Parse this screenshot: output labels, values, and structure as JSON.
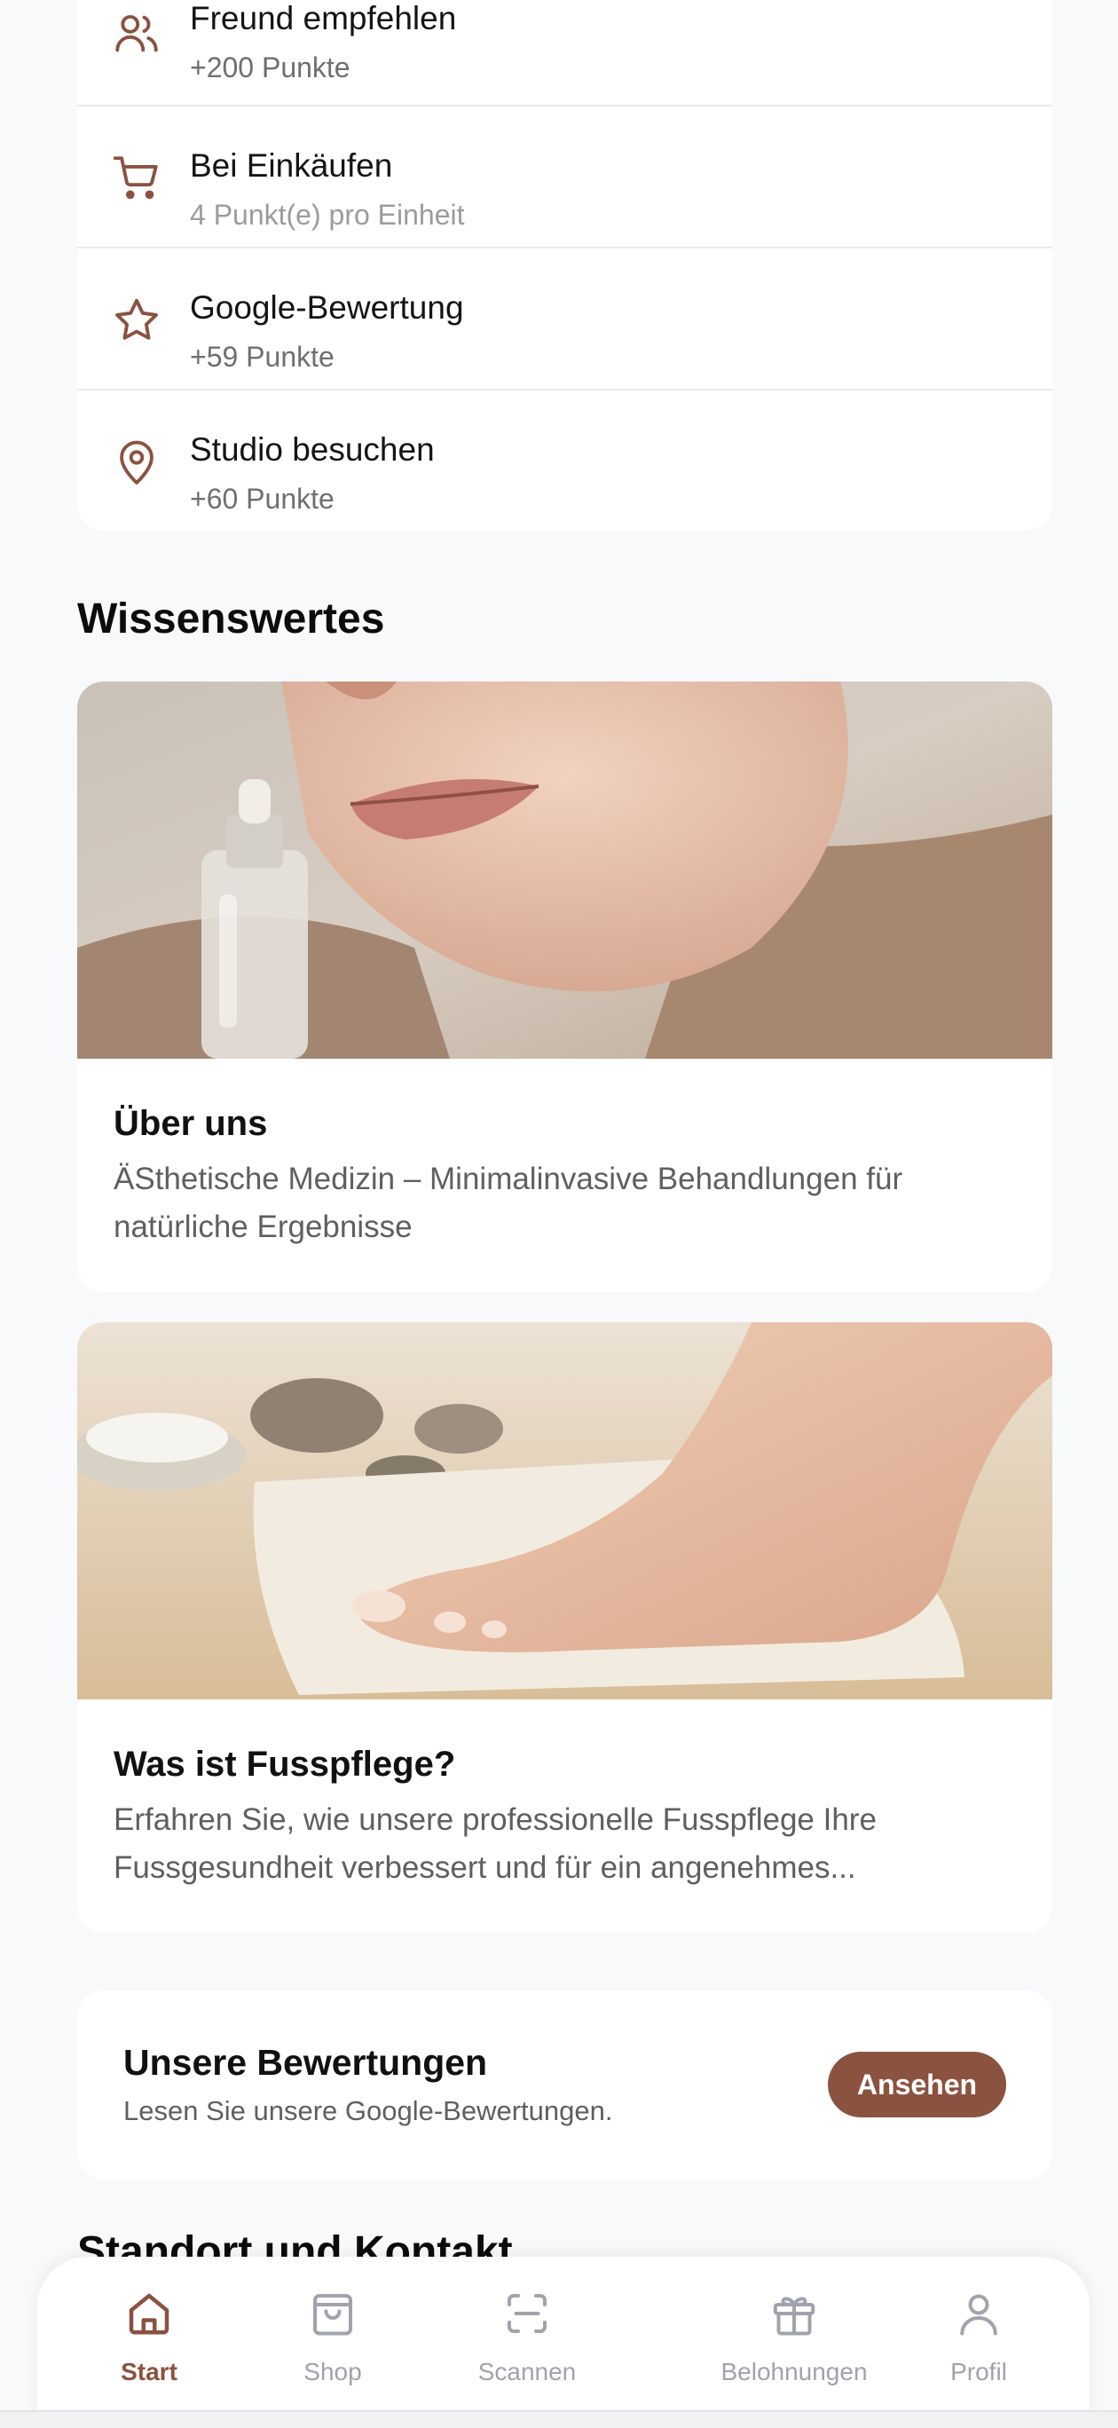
{
  "earn_items": [
    {
      "title": "Freund empfehlen",
      "subtitle": "+200 Punkte",
      "icon": "users-icon"
    },
    {
      "title": "Bei Einkäufen",
      "subtitle": "4 Punkt(e) pro Einheit",
      "icon": "cart-icon"
    },
    {
      "title": "Google-Bewertung",
      "subtitle": "+59 Punkte",
      "icon": "star-icon"
    },
    {
      "title": "Studio besuchen",
      "subtitle": "+60 Punkte",
      "icon": "map-pin-icon"
    }
  ],
  "knowledge": {
    "title": "Wissenswertes",
    "cards": [
      {
        "title": "Über uns",
        "description": "ÄSthetische Medizin – Minimalinvasive Behandlungen für natürliche Ergebnisse",
        "image": "serum-face-photo"
      },
      {
        "title": "Was ist Fusspflege?",
        "description": "Erfahren Sie, wie unsere professionelle Fusspflege Ihre Fussgesundheit verbessert und für ein angenehmes...",
        "image": "foot-care-photo"
      }
    ]
  },
  "reviews": {
    "title": "Unsere Bewertungen",
    "subtitle": "Lesen Sie unsere Google-Bewertungen.",
    "button": "Ansehen"
  },
  "next_section_title": "Standort und Kontakt",
  "nav": [
    {
      "label": "Start",
      "icon": "home-icon",
      "active": true
    },
    {
      "label": "Shop",
      "icon": "shopping-bag-icon",
      "active": false
    },
    {
      "label": "Scannen",
      "icon": "scan-icon",
      "active": false
    },
    {
      "label": "Belohnungen",
      "icon": "gift-icon",
      "active": false
    },
    {
      "label": "Profil",
      "icon": "user-icon",
      "active": false
    }
  ],
  "colors": {
    "accent": "#8b5240",
    "inactive": "#a0a3ad",
    "background": "#f8f9fb",
    "card": "#ffffff"
  }
}
